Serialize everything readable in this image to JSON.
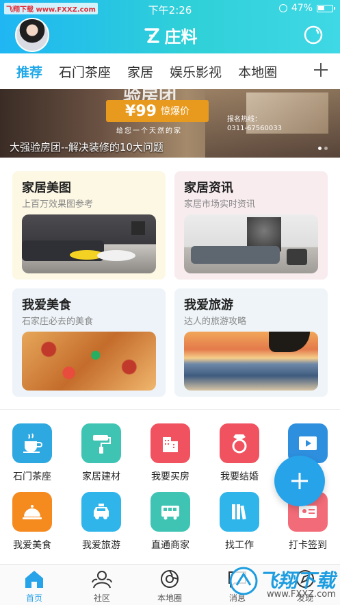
{
  "status_bar": {
    "left_badge": "飞翔下载 www.FXXZ.com",
    "time": "下午2:26",
    "battery": "47%"
  },
  "header": {
    "app_name": "庄料",
    "gradient_colors": [
      "#1fb6f3",
      "#3fd8e6"
    ]
  },
  "tabs": [
    "推荐",
    "石门茶座",
    "家居",
    "娱乐影视",
    "本地圈"
  ],
  "active_tab": "推荐",
  "accent_color": "#20a8e8",
  "banner": {
    "price": "¥99",
    "price_tag": "惊爆价",
    "slogan": "给您一个天然的家",
    "hotline_label": "报名热线：",
    "hotline": "0311-67560033",
    "partial_title": "验房团",
    "caption": "大强验房团--解决装修的10大问题"
  },
  "cards": [
    {
      "title": "家居美图",
      "subtitle": "上百万效果图参考"
    },
    {
      "title": "家居资讯",
      "subtitle": "家居市场实时资讯"
    },
    {
      "title": "我爱美食",
      "subtitle": "石家庄必去的美食"
    },
    {
      "title": "我爱旅游",
      "subtitle": "达人的旅游攻略"
    }
  ],
  "services_row1": [
    {
      "label": "石门茶座",
      "icon": "tea-cup-icon",
      "color": "#2ea8e0"
    },
    {
      "label": "家居建材",
      "icon": "paint-roller-icon",
      "color": "#3fc4b4"
    },
    {
      "label": "我要买房",
      "icon": "building-icon",
      "color": "#f0535f"
    },
    {
      "label": "我要结婚",
      "icon": "ring-icon",
      "color": "#f0535f"
    },
    {
      "label": "视频",
      "icon": "video-icon",
      "color": "#2e8fdf"
    }
  ],
  "services_row2": [
    {
      "label": "我爱美食",
      "icon": "food-cloche-icon",
      "color": "#f58a1f"
    },
    {
      "label": "我爱旅游",
      "icon": "taxi-icon",
      "color": "#2fb5ea"
    },
    {
      "label": "直通商家",
      "icon": "bus-icon",
      "color": "#3fc4b4"
    },
    {
      "label": "找工作",
      "icon": "books-icon",
      "color": "#2fb5ea"
    },
    {
      "label": "打卡签到",
      "icon": "id-card-icon",
      "color": "#f26b78"
    }
  ],
  "bottom_nav": [
    {
      "label": "首页",
      "icon": "home-icon",
      "active": true
    },
    {
      "label": "社区",
      "icon": "community-icon",
      "active": false
    },
    {
      "label": "本地圈",
      "icon": "camera-circle-icon",
      "active": false
    },
    {
      "label": "消息",
      "icon": "message-icon",
      "active": false
    },
    {
      "label": "发现",
      "icon": "discover-icon",
      "active": false
    }
  ],
  "watermark": {
    "text": "飞翔下载",
    "url": "www.FXXZ.com"
  }
}
